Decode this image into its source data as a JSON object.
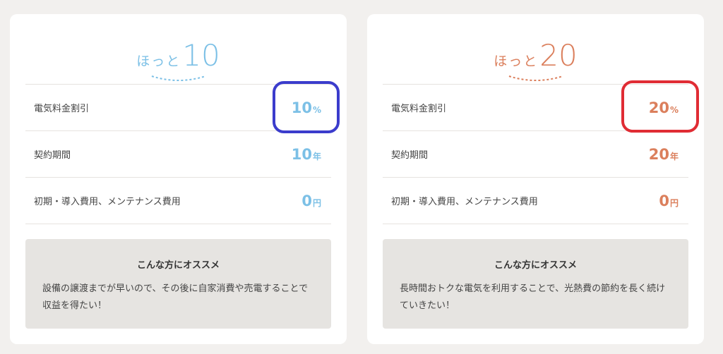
{
  "plans": [
    {
      "kana": "ほっと",
      "number": "10",
      "accent": "#7cc0e6",
      "rows": [
        {
          "label": "電気料金割引",
          "value": "10",
          "unit": "%"
        },
        {
          "label": "契約期間",
          "value": "10",
          "unit": "年"
        },
        {
          "label": "初期・導入費用、メンテナンス費用",
          "value": "0",
          "unit": "円"
        }
      ],
      "recommend": {
        "title": "こんな方にオススメ",
        "body": "設備の譲渡までが早いので、その後に自家消費や売電することで収益を得たい！"
      }
    },
    {
      "kana": "ほっと",
      "number": "20",
      "accent": "#db7f5c",
      "rows": [
        {
          "label": "電気料金割引",
          "value": "20",
          "unit": "%"
        },
        {
          "label": "契約期間",
          "value": "20",
          "unit": "年"
        },
        {
          "label": "初期・導入費用、メンテナンス費用",
          "value": "0",
          "unit": "円"
        }
      ],
      "recommend": {
        "title": "こんな方にオススメ",
        "body": "長時間おトクな電気を利用することで、光熱費の節約を長く続けていきたい！"
      }
    }
  ],
  "highlights": {
    "left_color": "#3b3ccc",
    "right_color": "#e02c34"
  }
}
